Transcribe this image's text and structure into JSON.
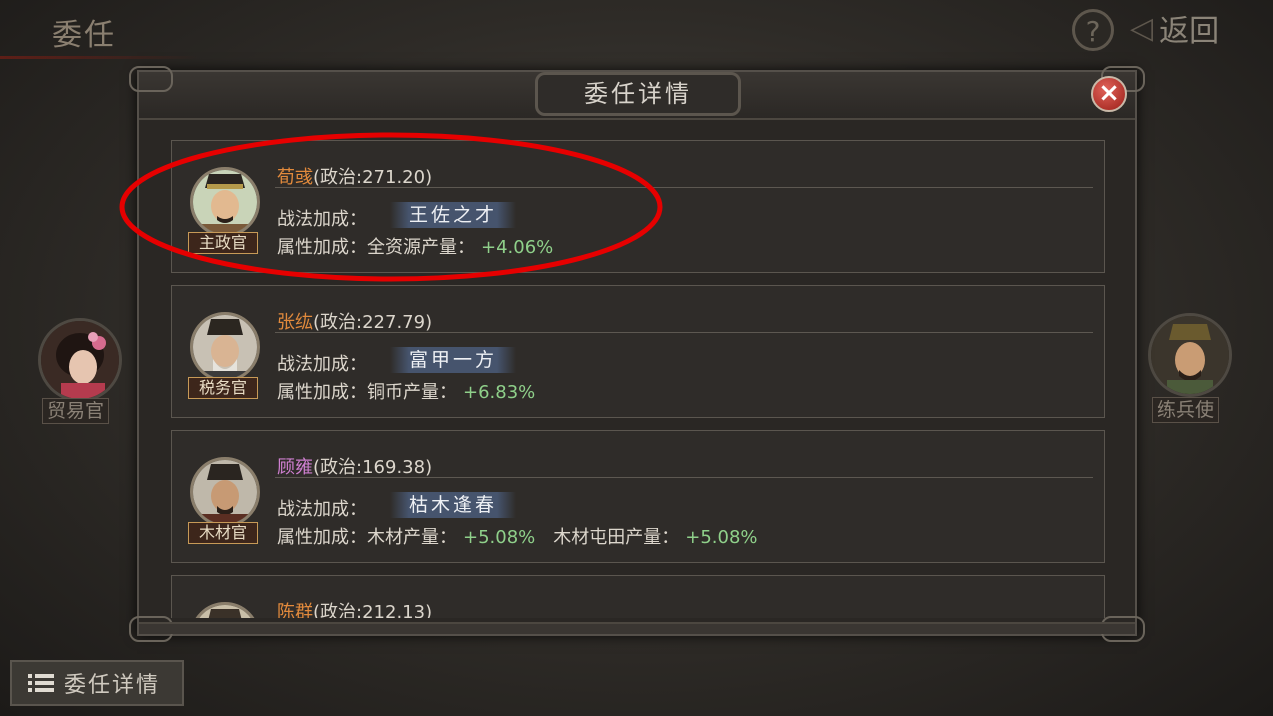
{
  "header": {
    "title": "委任",
    "help_icon": "?",
    "back_label": "返回"
  },
  "side": {
    "left_label": "贸易官",
    "right_label": "练兵使"
  },
  "modal": {
    "title": "委任详情",
    "close_icon": "×",
    "skill_prefix": "战法加成：",
    "attr_prefix": "属性加成：",
    "cards": [
      {
        "name": "荀彧",
        "name_color": "orange",
        "stat": "(政治:271.20)",
        "role": "主政官",
        "skill": "王佐之才",
        "attrs": [
          {
            "label": "全资源产量：",
            "value": "+4.06%"
          }
        ]
      },
      {
        "name": "张纮",
        "name_color": "orange",
        "stat": "(政治:227.79)",
        "role": "税务官",
        "skill": "富甲一方",
        "attrs": [
          {
            "label": "铜币产量：",
            "value": "+6.83%"
          }
        ]
      },
      {
        "name": "顾雍",
        "name_color": "purple",
        "stat": "(政治:169.38)",
        "role": "木材官",
        "skill": "枯木逢春",
        "attrs": [
          {
            "label": "木材产量：",
            "value": "+5.08%"
          },
          {
            "label": "木材屯田产量：",
            "value": "+5.08%"
          }
        ]
      },
      {
        "name": "陈群",
        "name_color": "orange",
        "stat": "(政治:212.13)"
      }
    ]
  },
  "footer": {
    "detail_button": "委任详情"
  },
  "colors": {
    "name_orange": "#e28a3c",
    "name_purple": "#cf7fd0",
    "bonus_green": "#8fd08a",
    "highlight_red": "#e60000"
  }
}
